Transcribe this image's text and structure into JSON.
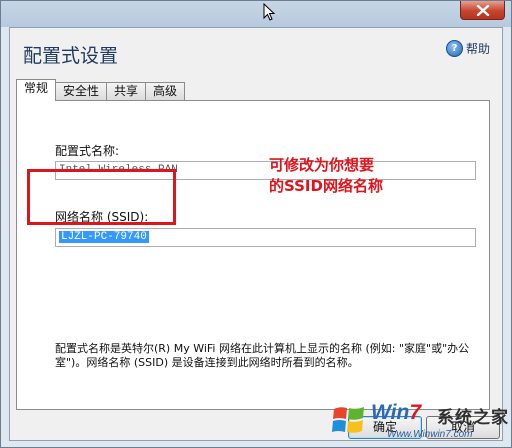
{
  "dialog": {
    "title": "配置式设置",
    "help_label": "帮助",
    "help_icon": "?"
  },
  "tabs": [
    {
      "label": "常规",
      "active": true
    },
    {
      "label": "安全性",
      "active": false
    },
    {
      "label": "共享",
      "active": false
    },
    {
      "label": "高级",
      "active": false
    }
  ],
  "fields": {
    "profile_name_label": "配置式名称:",
    "profile_name_value": "Intel Wireless PAN",
    "ssid_label": "网络名称 (SSID):",
    "ssid_value": "LJZL-PC-79740"
  },
  "annotation": {
    "line1": "可修改为你想要",
    "line2": "的SSID网络名称",
    "color": "#e0141c"
  },
  "description": "配置式名称是英特尔(R) My WiFi 网络在此计算机上显示的名称 (例如: \"家庭\"或\"办公室\")。网络名称 (SSID) 是设备连接到此网络时所看到的名称。",
  "buttons": {
    "ok_label": "确定",
    "cancel_label": "取消"
  },
  "watermark": {
    "win": "Win",
    "seven": "7",
    "cn": "系统之家",
    "url": "Www.Winwin7.com"
  }
}
